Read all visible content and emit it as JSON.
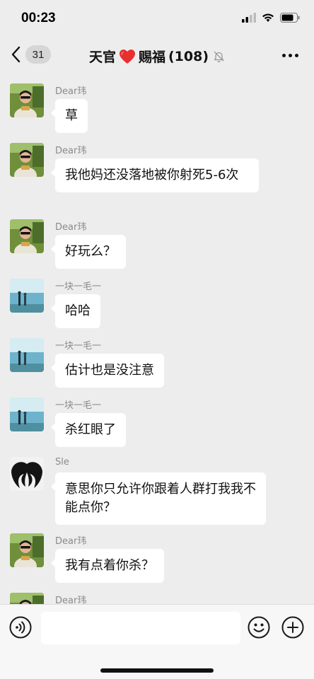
{
  "status_bar": {
    "time": "00:23"
  },
  "nav": {
    "back_count": "31",
    "title_left": "天官",
    "title_right": "赐福",
    "member_count": "(108)"
  },
  "messages": [
    {
      "sender": "Dear玮",
      "text": "草",
      "avatar": "avatar-dear"
    },
    {
      "sender": "Dear玮",
      "text": "我他妈还没落地被你射死5-6次",
      "avatar": "avatar-dear"
    },
    {
      "sender": "Dear玮",
      "text": "好玩么？",
      "avatar": "avatar-dear"
    },
    {
      "sender": "一块一毛一",
      "text": "哈哈",
      "avatar": "avatar-lake"
    },
    {
      "sender": "一块一毛一",
      "text": "估计也是没注意",
      "avatar": "avatar-lake"
    },
    {
      "sender": "一块一毛一",
      "text": "杀红眼了",
      "avatar": "avatar-lake"
    },
    {
      "sender": "Sle",
      "text": "意思你只允许你跟着人群打我我不能点你？",
      "avatar": "avatar-wings"
    },
    {
      "sender": "Dear玮",
      "text": "我有点着你杀？",
      "avatar": "avatar-dear"
    },
    {
      "sender": "Dear玮",
      "text": "",
      "avatar": "avatar-dear"
    }
  ],
  "input": {
    "placeholder": ""
  },
  "icons": {
    "back": "chevron-left-icon",
    "heart": "heart-icon",
    "mute": "muted-bell-icon",
    "more": "more-icon",
    "voice": "voice-icon",
    "emoji": "emoji-icon",
    "plus": "plus-icon"
  }
}
